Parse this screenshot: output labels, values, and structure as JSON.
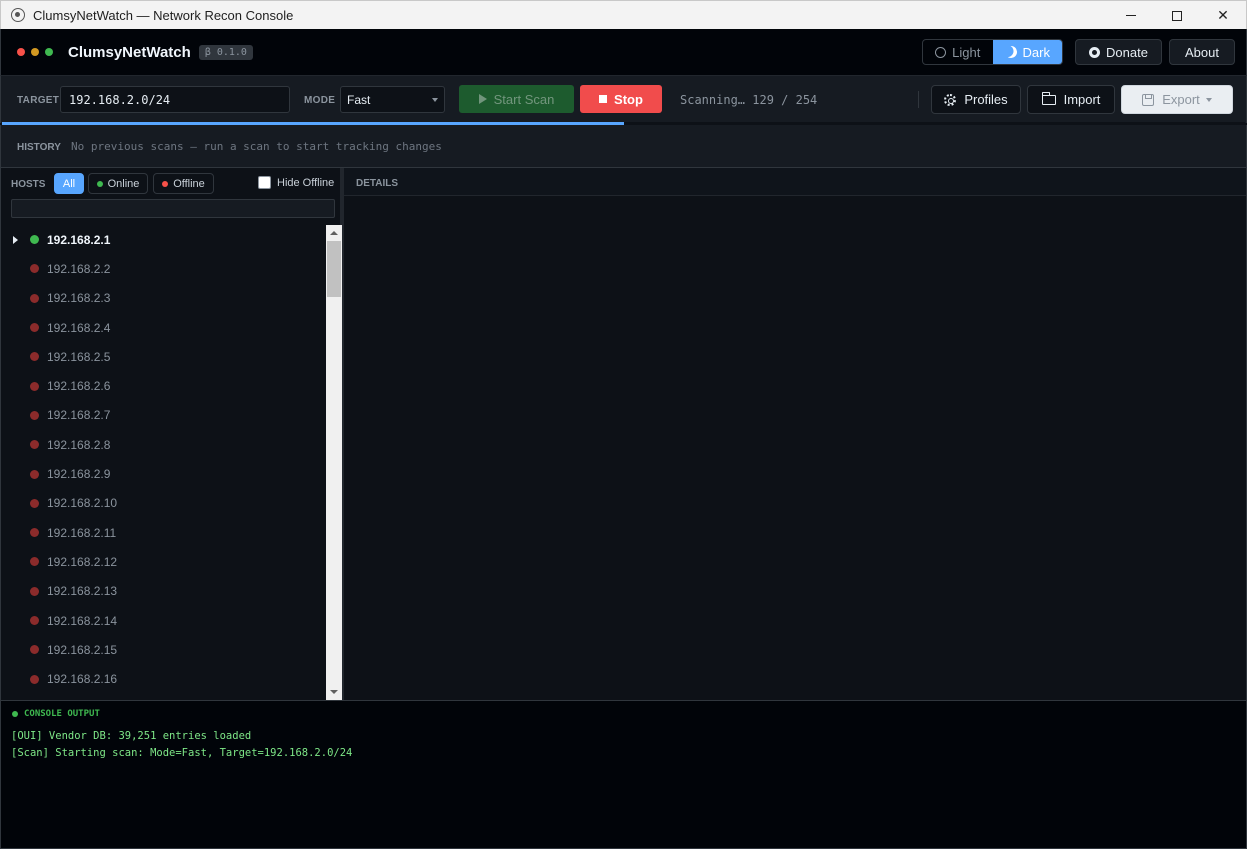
{
  "window": {
    "title": "ClumsyNetWatch — Network Recon Console"
  },
  "header": {
    "brand": "ClumsyNetWatch",
    "version": "β 0.1.0",
    "theme_light": "Light",
    "theme_dark": "Dark",
    "theme_active": "Dark",
    "donate": "Donate",
    "about": "About",
    "dot_colors": [
      "#f85149",
      "#d29922",
      "#3fb950"
    ]
  },
  "toolbar": {
    "target_label": "TARGET",
    "target_value": "192.168.2.0/24",
    "mode_label": "MODE",
    "mode_value": "Fast",
    "start_scan": "Start Scan",
    "stop": "Stop",
    "status": "Scanning… 129 / 254",
    "profiles": "Profiles",
    "import": "Import",
    "export": "Export",
    "progress_fraction": 0.5
  },
  "history": {
    "label": "HISTORY",
    "message": "No previous scans — run a scan to start tracking changes"
  },
  "hosts": {
    "label": "HOSTS",
    "filter_all": "All",
    "filter_online": "Online",
    "filter_offline": "Offline",
    "hide_offline": "Hide Offline",
    "search_value": "",
    "items": [
      {
        "ip": "192.168.2.1",
        "status": "online"
      },
      {
        "ip": "192.168.2.2",
        "status": "offline"
      },
      {
        "ip": "192.168.2.3",
        "status": "offline"
      },
      {
        "ip": "192.168.2.4",
        "status": "offline"
      },
      {
        "ip": "192.168.2.5",
        "status": "offline"
      },
      {
        "ip": "192.168.2.6",
        "status": "offline"
      },
      {
        "ip": "192.168.2.7",
        "status": "offline"
      },
      {
        "ip": "192.168.2.8",
        "status": "offline"
      },
      {
        "ip": "192.168.2.9",
        "status": "offline"
      },
      {
        "ip": "192.168.2.10",
        "status": "offline"
      },
      {
        "ip": "192.168.2.11",
        "status": "offline"
      },
      {
        "ip": "192.168.2.12",
        "status": "offline"
      },
      {
        "ip": "192.168.2.13",
        "status": "offline"
      },
      {
        "ip": "192.168.2.14",
        "status": "offline"
      },
      {
        "ip": "192.168.2.15",
        "status": "offline"
      },
      {
        "ip": "192.168.2.16",
        "status": "offline"
      }
    ]
  },
  "details": {
    "label": "DETAILS"
  },
  "console": {
    "label": "CONSOLE OUTPUT",
    "lines": [
      "[OUI] Vendor DB: 39,251 entries loaded",
      "[Scan] Starting scan: Mode=Fast, Target=192.168.2.0/24"
    ]
  },
  "colors": {
    "accent": "#58a6ff",
    "online": "#3fb950",
    "offline": "#8b2b2b",
    "stop": "#f14c4c",
    "start": "#238636"
  }
}
